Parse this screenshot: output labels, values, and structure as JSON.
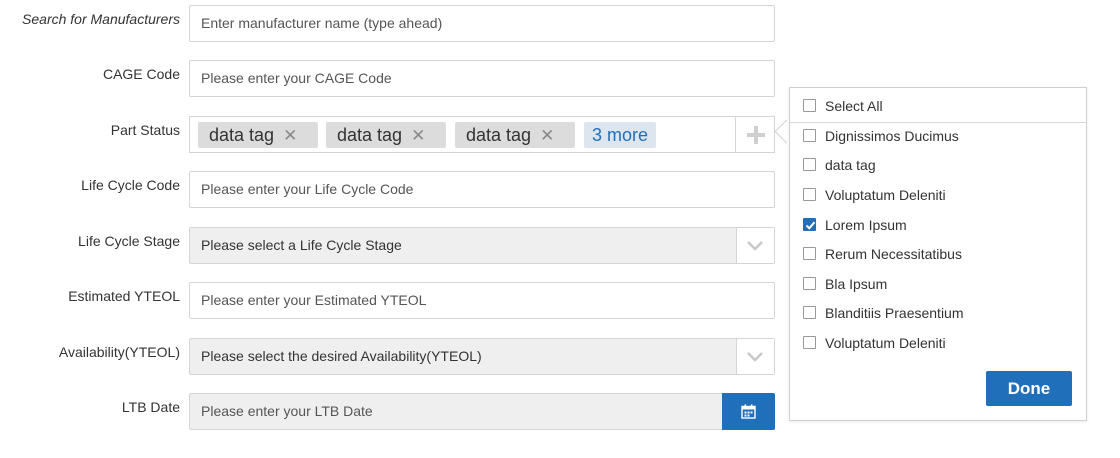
{
  "form": {
    "search": {
      "label": "Search for Manufacturers",
      "placeholder": "Enter manufacturer name (type ahead)"
    },
    "cage": {
      "label": "CAGE Code",
      "placeholder": "Please enter your CAGE Code"
    },
    "part_status": {
      "label": "Part Status",
      "tags": [
        "data tag",
        "data tag",
        "data tag"
      ],
      "more": "3 more"
    },
    "lifecycle_code": {
      "label": "Life Cycle Code",
      "placeholder": "Please enter your Life Cycle Code"
    },
    "lifecycle_stage": {
      "label": "Life Cycle Stage",
      "placeholder": "Please select a Life Cycle Stage"
    },
    "ytEOL": {
      "label": "Estimated YTEOL",
      "placeholder": "Please enter your Estimated YTEOL"
    },
    "availability": {
      "label": "Availability(YTEOL)",
      "placeholder": "Please select the desired Availability(YTEOL)"
    },
    "ltb": {
      "label": "LTB Date",
      "placeholder": "Please enter your LTB Date"
    }
  },
  "dropdown": {
    "select_all": "Select All",
    "options": [
      {
        "label": "Dignissimos Ducimus",
        "checked": false
      },
      {
        "label": "data tag",
        "checked": false
      },
      {
        "label": "Voluptatum Deleniti",
        "checked": false
      },
      {
        "label": "Lorem Ipsum",
        "checked": true
      },
      {
        "label": "Rerum Necessitatibus",
        "checked": false
      },
      {
        "label": "Bla Ipsum",
        "checked": false
      },
      {
        "label": "Blanditiis Praesentium",
        "checked": false
      },
      {
        "label": "Voluptatum Deleniti",
        "checked": false
      }
    ],
    "done_label": "Done"
  },
  "colors": {
    "accent": "#1f6fba",
    "tag_bg": "#dcdcdc",
    "select_bg": "#efefef"
  }
}
